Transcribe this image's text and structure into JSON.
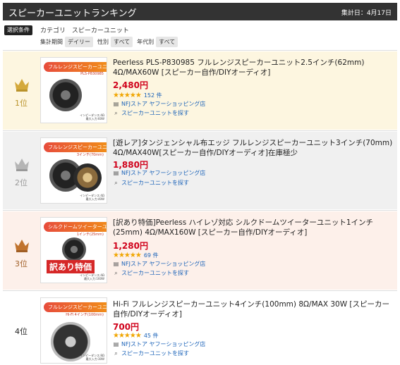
{
  "header": {
    "title": "スピーカーユニットランキング",
    "date": "集計日：4月17日"
  },
  "conditions": {
    "label": "選択条件",
    "category_label": "カテゴリ",
    "category_value": "スピーカーユニット",
    "filters": [
      {
        "label": "集計期間",
        "value": "デイリー"
      },
      {
        "label": "性別",
        "value": "すべて"
      },
      {
        "label": "年代別",
        "value": "すべて"
      }
    ]
  },
  "colors": {
    "price": "#d0021b",
    "link": "#1a62b8",
    "gold": "#b9932b",
    "silver": "#999999",
    "bronze": "#a05e25"
  },
  "items": [
    {
      "rank": "1位",
      "crown_color": "#b9932b",
      "name": "Peerless PLS-P830985 フルレンジスピーカーユニット2.5インチ(62mm) 4Ω/MAX60W [スピーカー自作/DIYオーディオ]",
      "price": "2,480円",
      "rating": 4.5,
      "stars": "★★★★★",
      "reviews": "152 件",
      "store": "NFJストア ヤフーショッピング店",
      "more": "スピーカーユニットを探す",
      "thumb": {
        "tag": "フルレンジスピーカーユニット",
        "sub": "PLS-P830985",
        "specs": [
          "インピーダンス:4Ω",
          "最大入力:60W"
        ]
      }
    },
    {
      "rank": "2位",
      "crown_color": "#999999",
      "name": "[遊レア]タンジェンシャル布エッジ フルレンジスピーカーユニット3インチ(70mm) 4Ω/MAX40W[スピーカー自作/DIYオーディオ]在庫極少",
      "price": "1,880円",
      "store": "NFJストア ヤフーショッピング店",
      "more": "スピーカーユニットを探す",
      "thumb": {
        "tag": "フルレンジスピーカーユニット",
        "sub": "3インチ(70mm)",
        "specs": [
          "インピーダンス:4Ω",
          "最大入力:40W"
        ]
      }
    },
    {
      "rank": "3位",
      "crown_color": "#a05e25",
      "name": "[訳あり特価]Peerless ハイレゾ対応 シルクドームツイーターユニット1インチ(25mm) 4Ω/MAX160W [スピーカー自作/DIYオーディオ]",
      "price": "1,280円",
      "rating": 4.5,
      "stars": "★★★★★",
      "reviews": "69 件",
      "store": "NFJストア ヤフーショッピング店",
      "more": "スピーカーユニットを探す",
      "thumb": {
        "tag": "シルクドームツイーターユニット",
        "sub": "1インチ(25mm)",
        "overlay": "訳あり特価",
        "specs": [
          "インピーダンス:4Ω",
          "最大入力:160W"
        ]
      }
    },
    {
      "rank": "4位",
      "name": "Hi-Fi フルレンジスピーカーユニット4インチ(100mm) 8Ω/MAX 30W [スピーカー自作/DIYオーディオ]",
      "price": "700円",
      "rating": 4.5,
      "stars": "★★★★★",
      "reviews": "45 件",
      "store": "NFJストア ヤフーショッピング店",
      "more": "スピーカーユニットを探す",
      "thumb": {
        "tag": "フルレンジスピーカーユニット",
        "sub": "Hi-Fi 4インチ(100mm)",
        "specs": [
          "インピーダンス:8Ω",
          "最大入力:30W"
        ]
      }
    }
  ]
}
